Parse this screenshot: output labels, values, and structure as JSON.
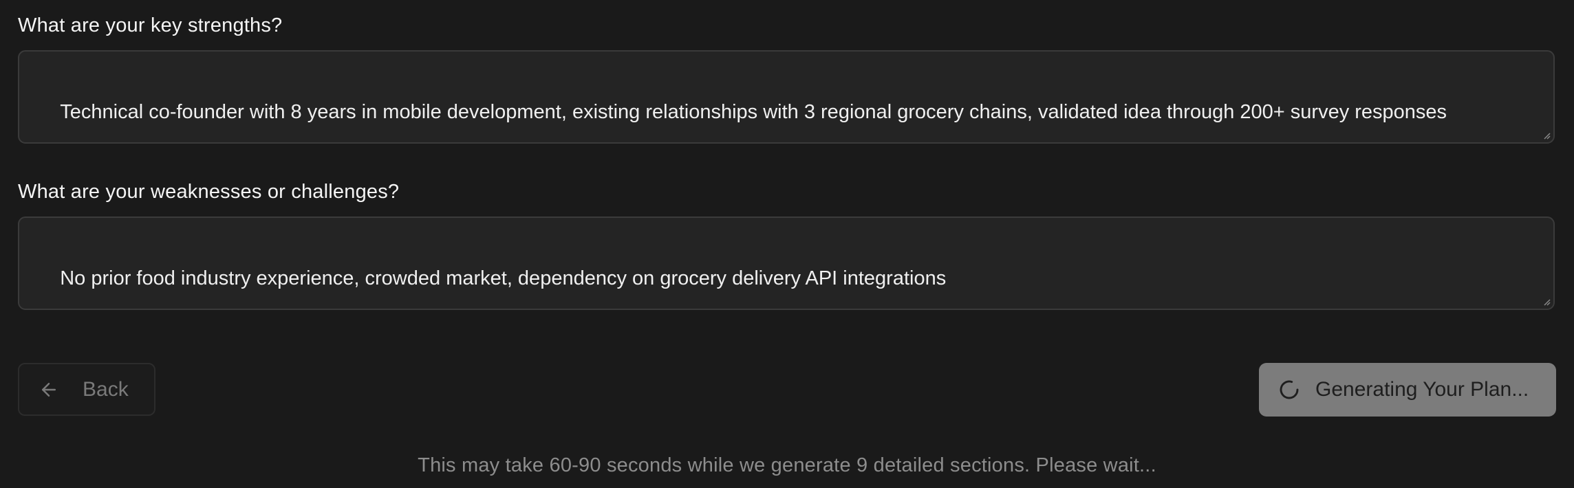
{
  "form": {
    "strengths": {
      "label": "What are your key strengths?",
      "value": "Technical co-founder with 8 years in mobile development, existing relationships with 3 regional grocery chains, validated idea through 200+ survey responses"
    },
    "weaknesses": {
      "label": "What are your weaknesses or challenges?",
      "value": "No prior food industry experience, crowded market, dependency on grocery delivery API integrations"
    }
  },
  "actions": {
    "back_label": "Back",
    "back_icon": "arrow-left-icon",
    "generate_label": "Generating Your Plan...",
    "generate_icon": "loading-spinner-icon",
    "generate_state": "loading"
  },
  "footer": {
    "note": "This may take 60-90 seconds while we generate 9 detailed sections. Please wait..."
  },
  "colors": {
    "background": "#1a1a1a",
    "textarea_bg": "#242424",
    "button_disabled_bg": "#7c7c7c"
  }
}
